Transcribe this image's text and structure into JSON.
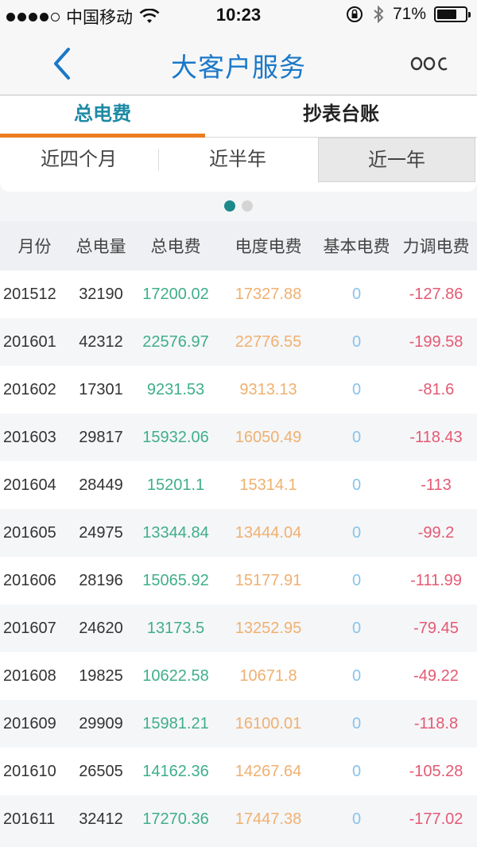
{
  "status_bar": {
    "carrier": "中国移动",
    "time": "10:23",
    "battery": "71%",
    "battery_level": 0.71
  },
  "nav": {
    "title": "大客户服务"
  },
  "tabs": [
    {
      "label": "总电费",
      "active": true
    },
    {
      "label": "抄表台账",
      "active": false
    }
  ],
  "periods": [
    {
      "label": "近四个月",
      "selected": false
    },
    {
      "label": "近半年",
      "selected": false
    },
    {
      "label": "近一年",
      "selected": true
    }
  ],
  "table": {
    "headers": [
      "月份",
      "总电量",
      "总电费",
      "电度电费",
      "基本电费",
      "力调电费"
    ],
    "rows": [
      [
        "201512",
        "32190",
        "17200.02",
        "17327.88",
        "0",
        "-127.86"
      ],
      [
        "201601",
        "42312",
        "22576.97",
        "22776.55",
        "0",
        "-199.58"
      ],
      [
        "201602",
        "17301",
        "9231.53",
        "9313.13",
        "0",
        "-81.6"
      ],
      [
        "201603",
        "29817",
        "15932.06",
        "16050.49",
        "0",
        "-118.43"
      ],
      [
        "201604",
        "28449",
        "15201.1",
        "15314.1",
        "0",
        "-113"
      ],
      [
        "201605",
        "24975",
        "13344.84",
        "13444.04",
        "0",
        "-99.2"
      ],
      [
        "201606",
        "28196",
        "15065.92",
        "15177.91",
        "0",
        "-111.99"
      ],
      [
        "201607",
        "24620",
        "13173.5",
        "13252.95",
        "0",
        "-79.45"
      ],
      [
        "201608",
        "19825",
        "10622.58",
        "10671.8",
        "0",
        "-49.22"
      ],
      [
        "201609",
        "29909",
        "15981.21",
        "16100.01",
        "0",
        "-118.8"
      ],
      [
        "201610",
        "26505",
        "14162.36",
        "14267.64",
        "0",
        "-105.28"
      ],
      [
        "201611",
        "32412",
        "17270.36",
        "17447.38",
        "0",
        "-177.02"
      ]
    ]
  },
  "colors": {
    "nav_title": "#1a78c8",
    "tab_active_text": "#1d8aa5",
    "tab_indicator": "#ec7d22",
    "total_fee": "#3fae8b",
    "energy_fee": "#f0b070",
    "base_fee": "#88c4ea",
    "adjust_fee": "#e45a73"
  },
  "icons": {
    "back": "chevron-left-icon",
    "more": "more-icon",
    "wifi": "wifi-icon",
    "lock": "rotation-lock-icon",
    "bluetooth": "bluetooth-icon"
  }
}
